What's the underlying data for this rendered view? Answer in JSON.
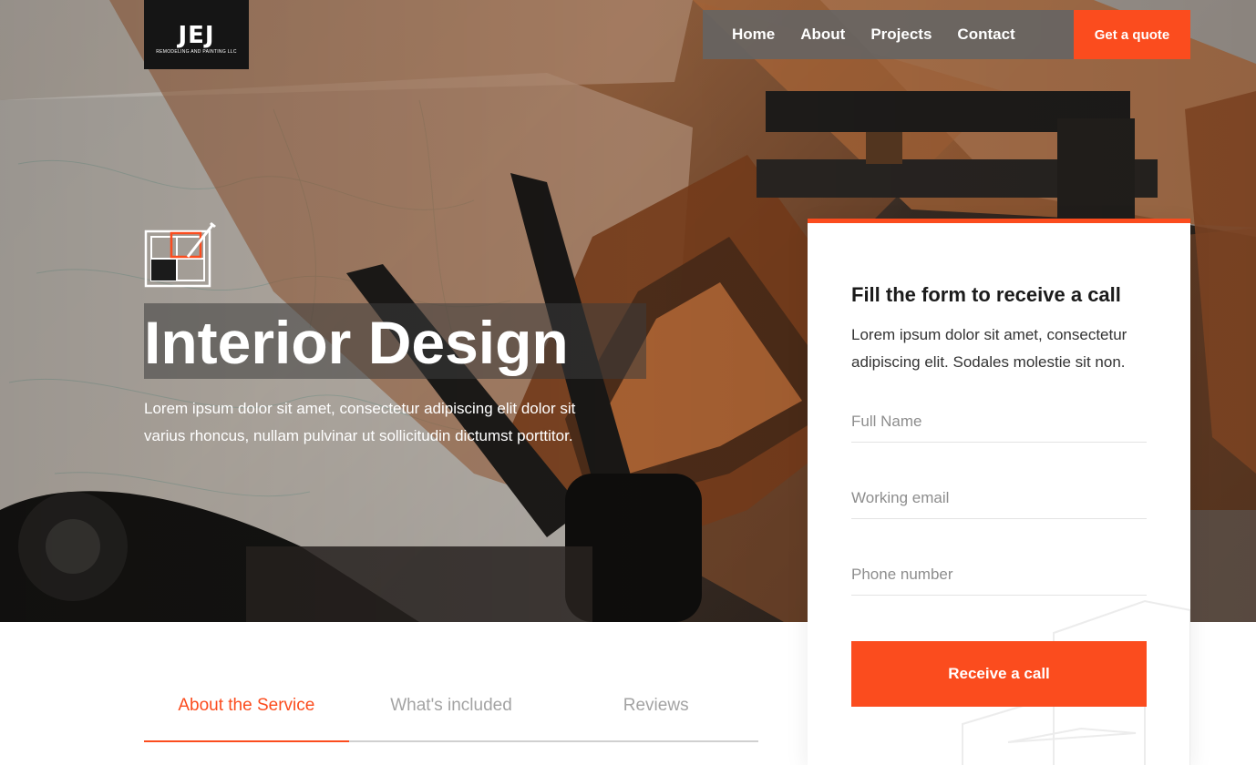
{
  "brand": {
    "logo_text": "JEJ",
    "logo_subtext": "REMODELING AND PAINTING LLC",
    "accent_color": "#fb4c1e"
  },
  "nav": {
    "items": [
      {
        "label": "Home"
      },
      {
        "label": "About"
      },
      {
        "label": "Projects"
      },
      {
        "label": "Contact"
      }
    ],
    "cta_label": "Get a quote"
  },
  "hero": {
    "icon": "interior-design-icon",
    "title": "Interior Design",
    "description": "Lorem ipsum dolor sit amet, consectetur adipiscing elit dolor sit varius rhoncus, nullam pulvinar ut sollicitudin dictumst porttitor."
  },
  "form": {
    "title": "Fill the form to receive a call",
    "description": "Lorem ipsum dolor sit amet, consectetur adipiscing elit. Sodales molestie sit non.",
    "fields": [
      {
        "placeholder": "Full Name",
        "value": ""
      },
      {
        "placeholder": "Working email",
        "value": ""
      },
      {
        "placeholder": "Phone number",
        "value": ""
      }
    ],
    "submit_label": "Receive a call"
  },
  "tabs": [
    {
      "label": "About the Service",
      "active": true
    },
    {
      "label": "What's included",
      "active": false
    },
    {
      "label": "Reviews",
      "active": false
    }
  ]
}
